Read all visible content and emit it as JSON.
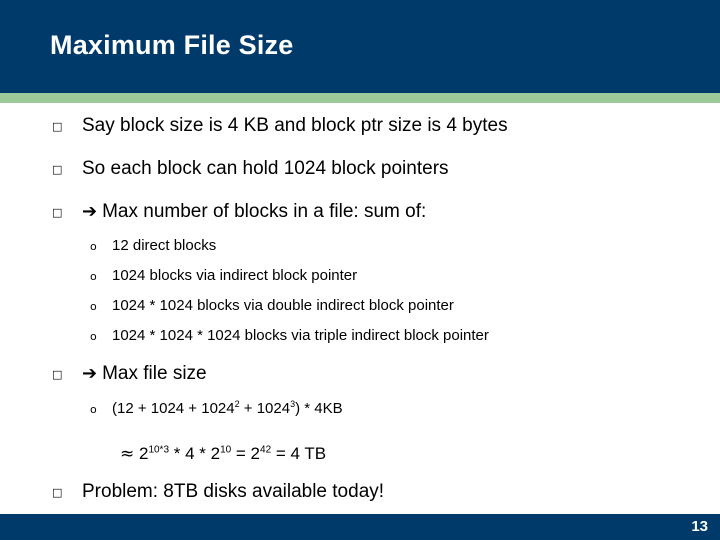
{
  "slide": {
    "title": "Maximum File Size",
    "page_number": "13",
    "colors": {
      "banner": "#003a6b",
      "accent": "#9ccb99",
      "text": "#000000",
      "title_text": "#ffffff"
    },
    "bullet_marker": "□",
    "sub_bullet_marker": "o",
    "arrow_marker": "➔"
  },
  "bullets": [
    {
      "text": "Say block size is 4 KB and block ptr size is 4 bytes",
      "marker": "□"
    },
    {
      "text": "So each block can hold 1024 block pointers",
      "marker": "□"
    },
    {
      "text": "Max number of blocks in a file: sum of:",
      "marker": "□",
      "arrow": "➔"
    },
    {
      "text": "Max file size",
      "marker": "□",
      "arrow": "➔"
    },
    {
      "text": "Problem: 8TB disks available today!",
      "marker": "□"
    }
  ],
  "sub_bullets": [
    {
      "text": "12 direct blocks",
      "marker": "o"
    },
    {
      "text": "1024 blocks via indirect block pointer",
      "marker": "o"
    },
    {
      "text": "1024 * 1024 blocks via double indirect block pointer",
      "marker": "o"
    },
    {
      "text": "1024 * 1024 * 1024 blocks via triple indirect block pointer",
      "marker": "o"
    }
  ],
  "max_file_size_formula": {
    "marker": "o",
    "prefix": "(12 + 1024 + 1024",
    "exp1": "2",
    "mid": " + 1024",
    "exp2": "3",
    "suffix": ") * 4KB"
  },
  "approximation": {
    "approx_symbol": "≈",
    "base1": " 2",
    "exp1": "10*3",
    "op1": " * 4 * 2",
    "exp2": "10",
    "op2": " = 2",
    "exp3": "42",
    "tail": " = 4 TB"
  }
}
